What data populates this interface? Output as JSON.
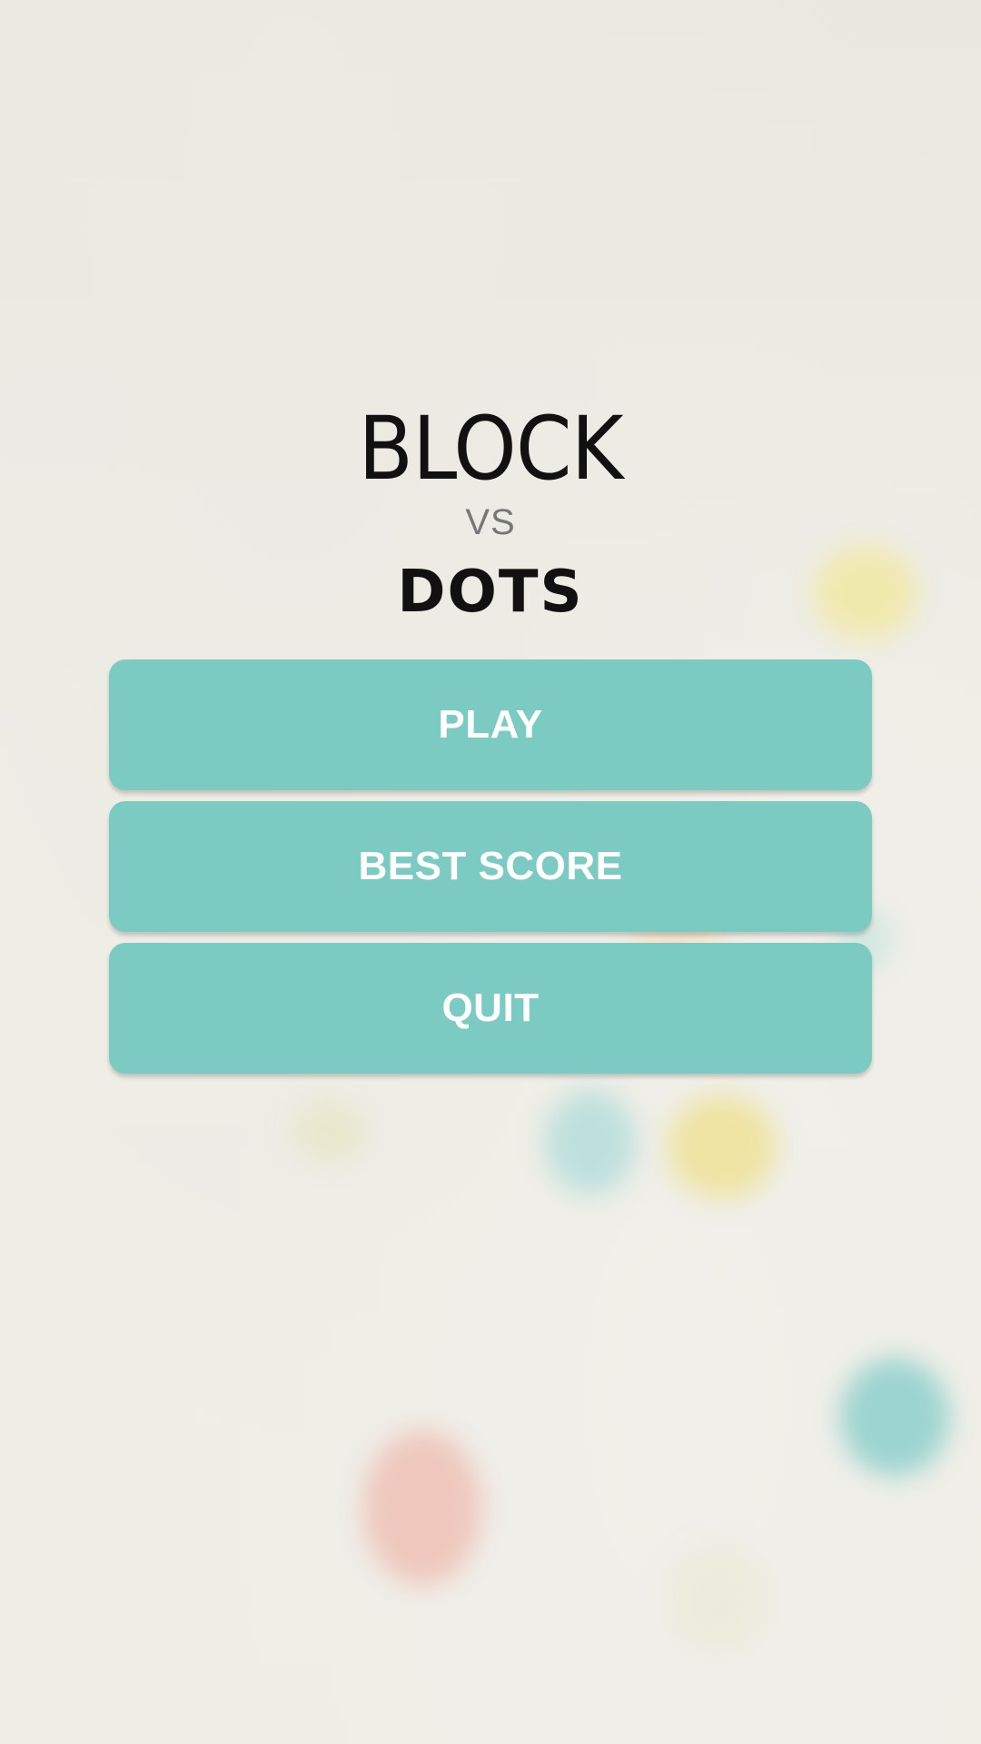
{
  "logo": {
    "title_top": "BLOCK",
    "title_middle": "VS",
    "title_bottom": "DOTS"
  },
  "menu": {
    "play_label": "PLAY",
    "best_score_label": "BEST SCORE",
    "quit_label": "QUIT"
  },
  "colors": {
    "button_bg": "#7bcbc3",
    "button_text": "#ffffff",
    "logo_text": "#111111",
    "vs_text": "#777777",
    "background": "#eceae2"
  }
}
